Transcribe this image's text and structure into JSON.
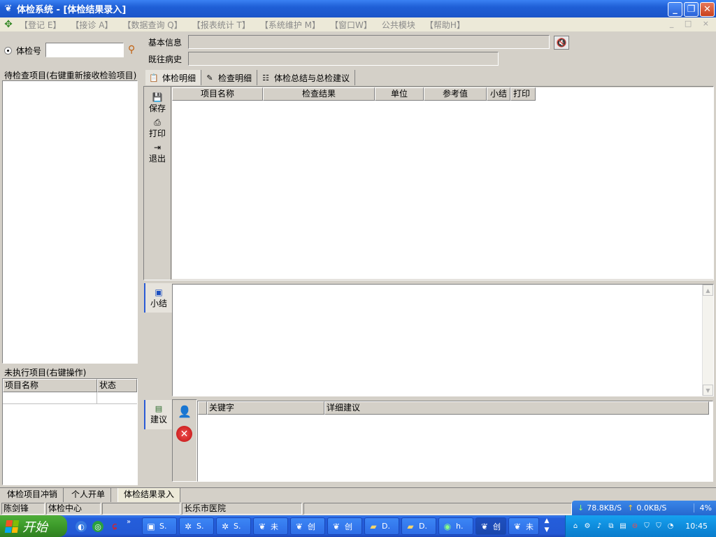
{
  "window": {
    "title": "体检系统 - [体检结果录入]",
    "buttons": [
      "minimize",
      "restore",
      "close"
    ]
  },
  "menu": {
    "items": [
      "【登记 E】",
      "【接诊 A】",
      "【数据查询 Q】",
      "【报表统计 T】",
      "【系统维护 M】",
      "【窗口W】",
      "公共模块",
      "【帮助H】"
    ],
    "mdi_controls": "_ □ ×"
  },
  "search": {
    "radio_label": "体检号",
    "value": ""
  },
  "info": {
    "basic_label": "基本信息",
    "basic_value": "",
    "history_label": "既往病史",
    "history_value": ""
  },
  "pending": {
    "title": "待检查项目(右键重新接收检验项目)",
    "items": []
  },
  "unexecuted": {
    "title": "未执行项目(右键操作)",
    "columns": [
      "项目名称",
      "状态"
    ],
    "rows": []
  },
  "tabs": [
    {
      "label": "体检明细",
      "icon": "clipboard-icon",
      "active": true
    },
    {
      "label": "检查明细",
      "icon": "tools-icon",
      "active": false
    },
    {
      "label": "体检总结与总检建议",
      "icon": "document-icon",
      "active": false
    }
  ],
  "toolbar": {
    "save_label": "保存",
    "print_label": "打印",
    "exit_label": "退出"
  },
  "detail_table": {
    "columns": [
      "项目名称",
      "检查结果",
      "单位",
      "参考值",
      "小结",
      "打印"
    ],
    "rows": []
  },
  "summary": {
    "label": "小结",
    "text": ""
  },
  "suggestion": {
    "label": "建议",
    "columns": [
      "关键字",
      "详细建议"
    ],
    "rows": []
  },
  "bottom_tabs": [
    "体检项目冲销",
    "个人开单",
    "体检结果录入"
  ],
  "active_bottom_tab": "体检结果录入",
  "status_bar": {
    "user": "陈剑锋",
    "department": "体检中心",
    "empty": "",
    "hospital": "长乐市医院"
  },
  "network": {
    "down": "78.8KB/S",
    "up": "0.0KB/S",
    "percent": "4%"
  },
  "taskbar": {
    "start_label": "开始",
    "tasks": [
      {
        "label": "S.",
        "icon": "monitor-icon"
      },
      {
        "label": "S.",
        "icon": "gear-icon"
      },
      {
        "label": "S.",
        "icon": "gear-icon"
      },
      {
        "label": "未",
        "icon": "app-icon"
      },
      {
        "label": "创",
        "icon": "app-icon"
      },
      {
        "label": "创",
        "icon": "app-icon"
      },
      {
        "label": "D.",
        "icon": "folder-icon"
      },
      {
        "label": "D.",
        "icon": "folder-icon"
      },
      {
        "label": "h.",
        "icon": "browser-icon"
      },
      {
        "label": "创",
        "icon": "app-icon"
      },
      {
        "label": "未",
        "icon": "app-icon"
      }
    ],
    "clock": "10:45"
  },
  "colors": {
    "titlebar": "#245edb",
    "face": "#d4d0c8",
    "menubar": "#ece9d8",
    "taskbar": "#2359d5",
    "start": "#3c9a2a",
    "tray": "#0f8ddd",
    "network_bar": "#2b72d6"
  }
}
